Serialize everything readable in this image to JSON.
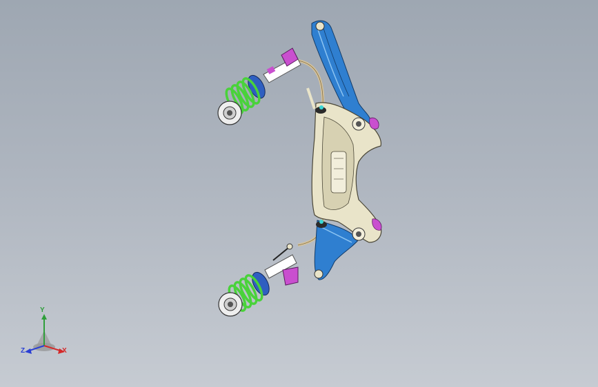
{
  "viewport": {
    "background_top": "#9ea7b2",
    "background_bottom": "#c6cbd2"
  },
  "model": {
    "parts": [
      "front-subframe",
      "lower-control-arm-left",
      "lower-control-arm-right",
      "strut-assembly-upper",
      "strut-assembly-lower",
      "stabilizer-bar",
      "stabilizer-link-upper",
      "stabilizer-link-lower"
    ],
    "colors": {
      "subframe": "#e9e4c9",
      "control_arm": "#2f7fd0",
      "coil_spring": "#49d23a",
      "strut_mount": "#c94fcf",
      "stabilizer_bar": "#d8c49a",
      "hub": "#eeeeee"
    }
  },
  "triad": {
    "y_label": "Y",
    "x_label": "X",
    "z_label": "Z",
    "y_color": "#2e9e3a",
    "x_color": "#d42a2a",
    "z_color": "#2a3fd4"
  }
}
